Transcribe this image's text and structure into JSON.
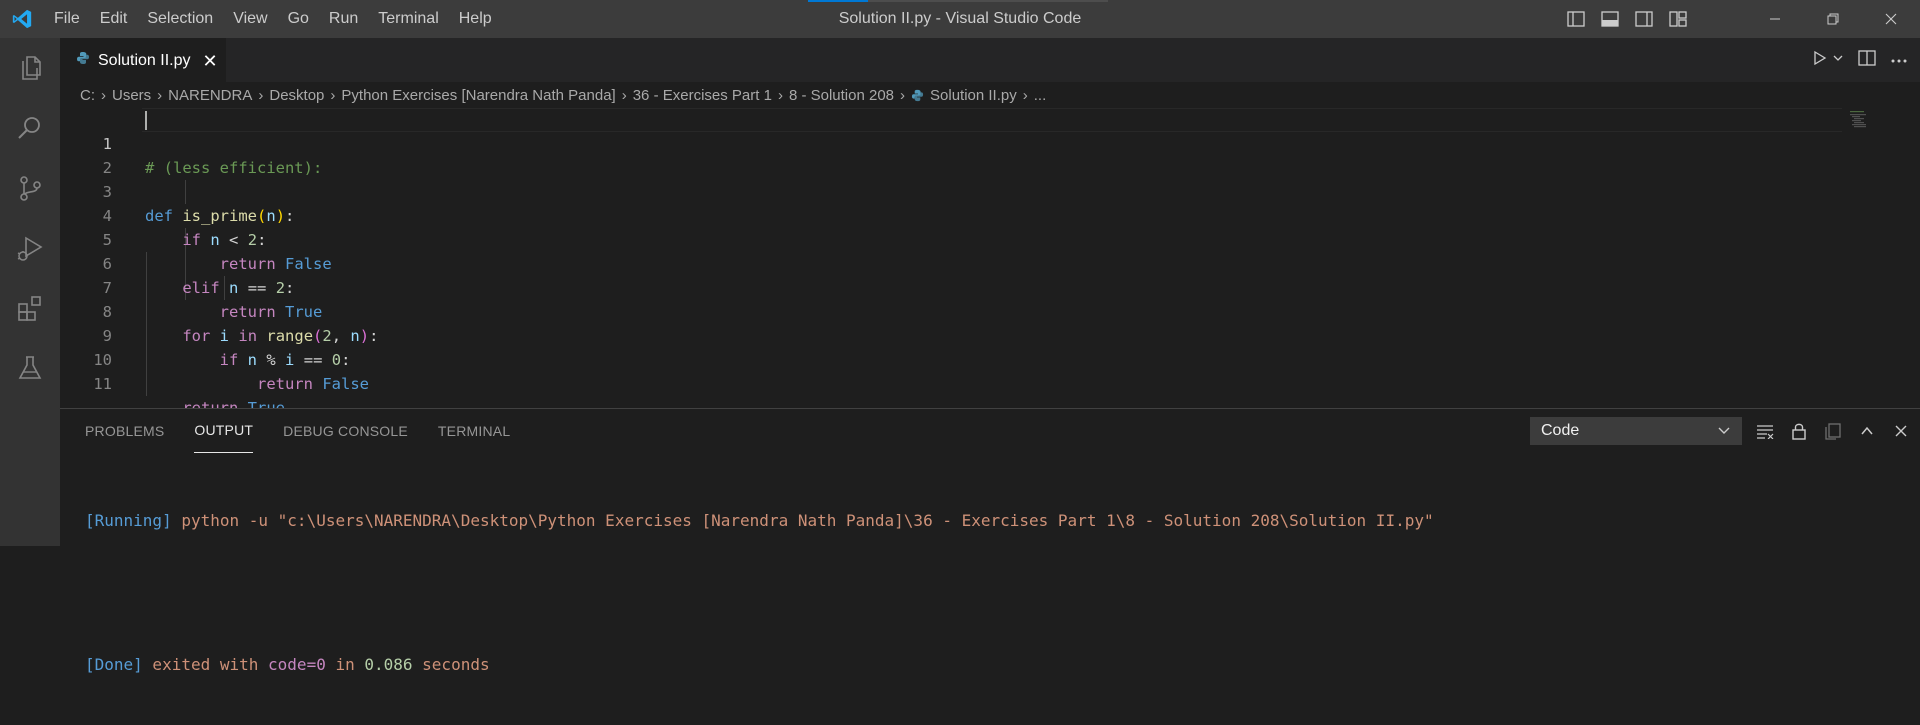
{
  "titlebar": {
    "menu": [
      "File",
      "Edit",
      "Selection",
      "View",
      "Go",
      "Run",
      "Terminal",
      "Help"
    ],
    "window_title": "Solution II.py - Visual Studio Code"
  },
  "activitybar": {
    "icons": [
      "explorer-icon",
      "search-icon",
      "source-control-icon",
      "run-debug-icon",
      "extensions-icon",
      "testing-icon"
    ]
  },
  "tab": {
    "label": "Solution II.py",
    "close": "✕"
  },
  "breadcrumb": {
    "items": [
      "C:",
      "Users",
      "NARENDRA",
      "Desktop",
      "Python Exercises [Narendra Nath Panda]",
      "36 - Exercises Part 1",
      "8 - Solution 208",
      "Solution II.py",
      "..."
    ]
  },
  "editor": {
    "line_numbers": [
      "1",
      "2",
      "3",
      "4",
      "5",
      "6",
      "7",
      "8",
      "9",
      "10",
      "11"
    ],
    "active_line": "1"
  },
  "panel": {
    "tabs": [
      "PROBLEMS",
      "OUTPUT",
      "DEBUG CONSOLE",
      "TERMINAL"
    ],
    "active_tab": "OUTPUT",
    "select_value": "Code",
    "output": {
      "running_tag": "[Running]",
      "running_cmd": " python -u \"c:\\Users\\NARENDRA\\Desktop\\Python Exercises [Narendra Nath Panda]\\36 - Exercises Part 1\\8 - Solution 208\\Solution II.py\"",
      "done_tag": "[Done]",
      "done_text_1": " exited with ",
      "done_code": "code=0",
      "done_text_2": " in ",
      "done_time": "0.086",
      "done_text_3": " seconds"
    }
  },
  "colors": {
    "accent": "#0078d4",
    "titlebar": "#3c3c3c",
    "activitybar": "#333333",
    "editor_bg": "#1e1e1e",
    "python_icon": "#519aba"
  }
}
